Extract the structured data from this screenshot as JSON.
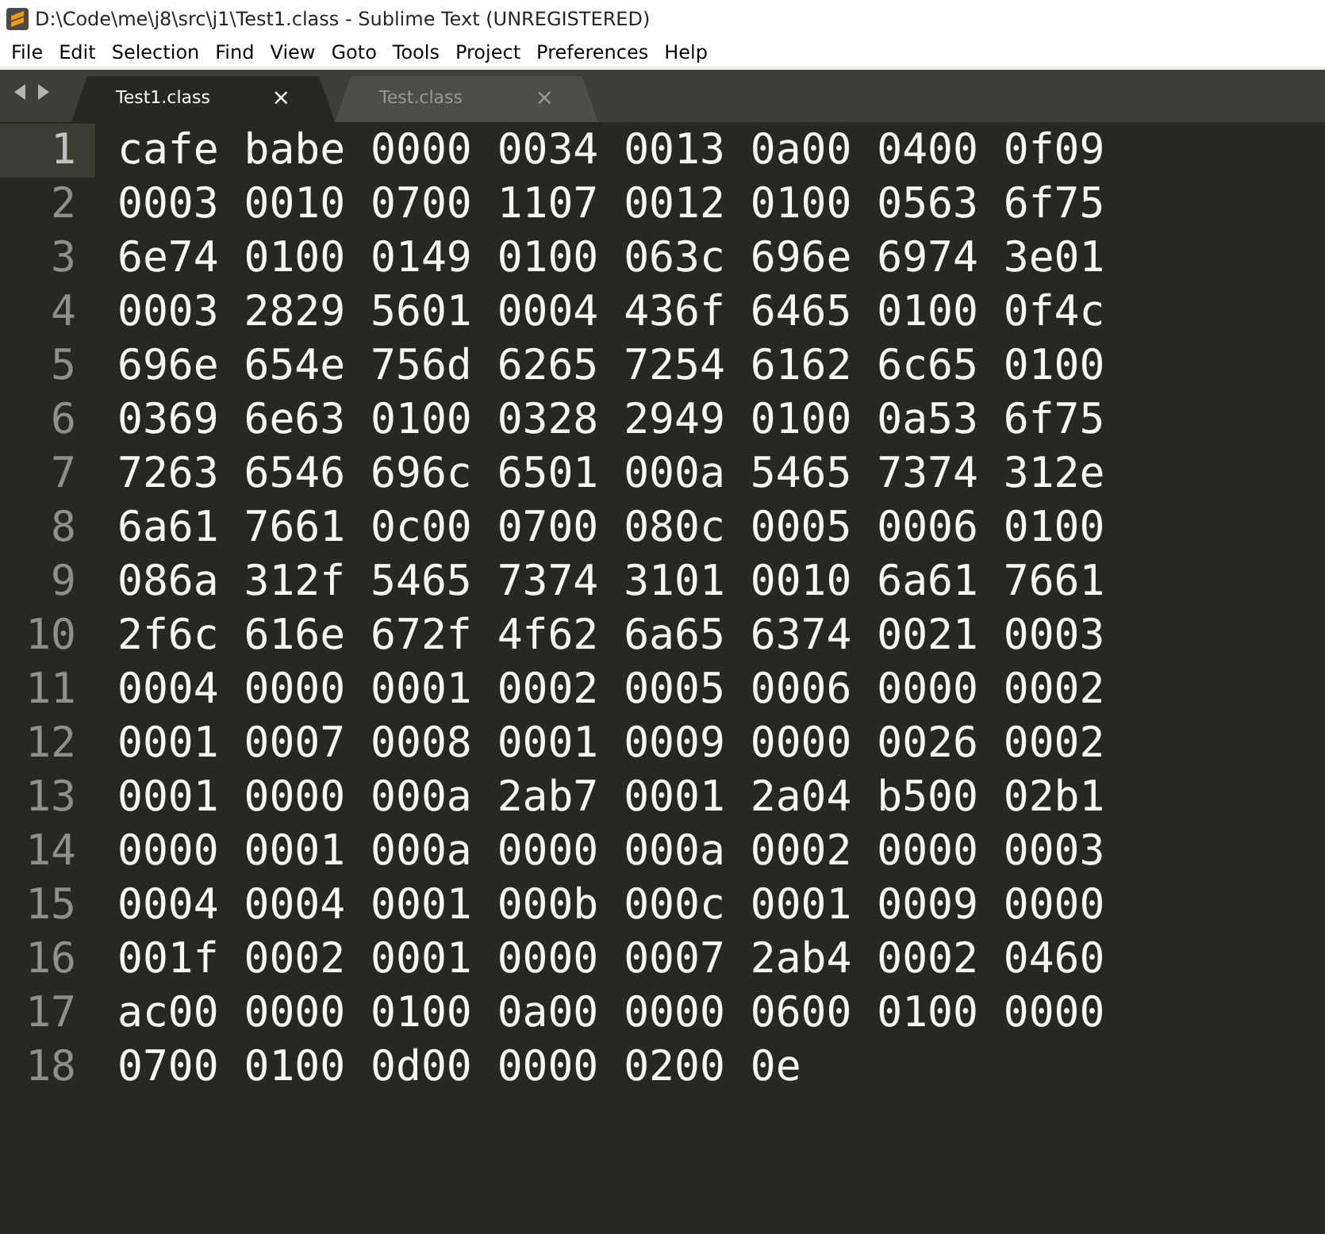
{
  "window": {
    "title": "D:\\Code\\me\\j8\\src\\j1\\Test1.class - Sublime Text (UNREGISTERED)"
  },
  "menu": [
    "File",
    "Edit",
    "Selection",
    "Find",
    "View",
    "Goto",
    "Tools",
    "Project",
    "Preferences",
    "Help"
  ],
  "tabs": [
    {
      "label": "Test1.class",
      "selected": true,
      "close": "×"
    },
    {
      "label": "Test.class",
      "selected": false,
      "close": "×"
    }
  ],
  "lines": [
    {
      "number": "1",
      "text": "cafe babe 0000 0034 0013 0a00 0400 0f09",
      "current": true
    },
    {
      "number": "2",
      "text": "0003 0010 0700 1107 0012 0100 0563 6f75",
      "current": false
    },
    {
      "number": "3",
      "text": "6e74 0100 0149 0100 063c 696e 6974 3e01",
      "current": false
    },
    {
      "number": "4",
      "text": "0003 2829 5601 0004 436f 6465 0100 0f4c",
      "current": false
    },
    {
      "number": "5",
      "text": "696e 654e 756d 6265 7254 6162 6c65 0100",
      "current": false
    },
    {
      "number": "6",
      "text": "0369 6e63 0100 0328 2949 0100 0a53 6f75",
      "current": false
    },
    {
      "number": "7",
      "text": "7263 6546 696c 6501 000a 5465 7374 312e",
      "current": false
    },
    {
      "number": "8",
      "text": "6a61 7661 0c00 0700 080c 0005 0006 0100",
      "current": false
    },
    {
      "number": "9",
      "text": "086a 312f 5465 7374 3101 0010 6a61 7661",
      "current": false
    },
    {
      "number": "10",
      "text": "2f6c 616e 672f 4f62 6a65 6374 0021 0003",
      "current": false
    },
    {
      "number": "11",
      "text": "0004 0000 0001 0002 0005 0006 0000 0002",
      "current": false
    },
    {
      "number": "12",
      "text": "0001 0007 0008 0001 0009 0000 0026 0002",
      "current": false
    },
    {
      "number": "13",
      "text": "0001 0000 000a 2ab7 0001 2a04 b500 02b1",
      "current": false
    },
    {
      "number": "14",
      "text": "0000 0001 000a 0000 000a 0002 0000 0003",
      "current": false
    },
    {
      "number": "15",
      "text": "0004 0004 0001 000b 000c 0001 0009 0000",
      "current": false
    },
    {
      "number": "16",
      "text": "001f 0002 0001 0000 0007 2ab4 0002 0460",
      "current": false
    },
    {
      "number": "17",
      "text": "ac00 0000 0100 0a00 0000 0600 0100 0000",
      "current": false
    },
    {
      "number": "18",
      "text": "0700 0100 0d00 0000 0200 0e",
      "current": false
    }
  ]
}
